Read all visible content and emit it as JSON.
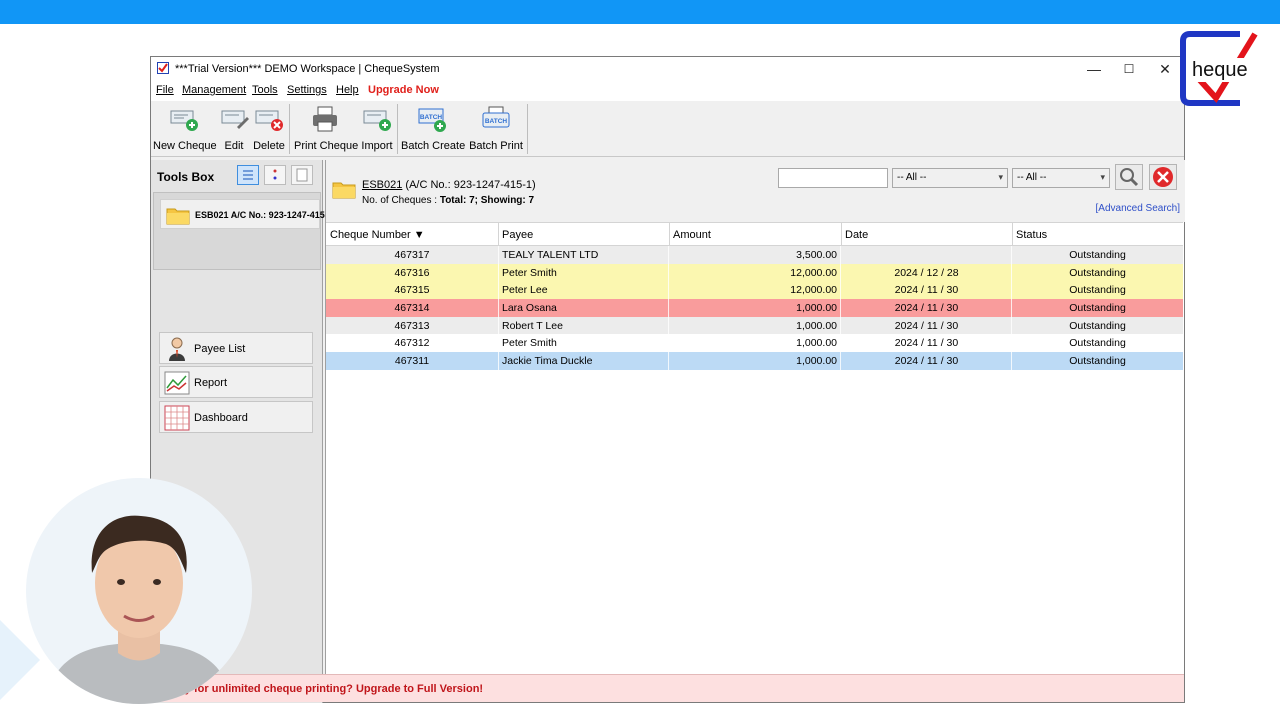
{
  "window": {
    "title": "***Trial Version*** DEMO Workspace | ChequeSystem",
    "controls": {
      "minimize": "—",
      "maximize": "☐",
      "close": "✕"
    }
  },
  "menu": {
    "items": [
      "File",
      "Management",
      "Tools",
      "Settings",
      "Help"
    ],
    "upgrade": "Upgrade Now"
  },
  "toolbar": {
    "buttons": [
      {
        "label": "New Cheque",
        "icon": "new-cheque-icon"
      },
      {
        "label": "Edit",
        "icon": "edit-icon"
      },
      {
        "label": "Delete",
        "icon": "delete-icon"
      },
      {
        "label": "Print Cheque",
        "icon": "printer-icon"
      },
      {
        "label": "Import",
        "icon": "import-icon"
      },
      {
        "label": "Batch Create",
        "icon": "batch-create-icon"
      },
      {
        "label": "Batch Print",
        "icon": "batch-print-icon"
      }
    ],
    "batch_badge": "BATCH"
  },
  "toolsbox": {
    "title": "Tools Box",
    "account_item": "ESB021 A/C No.: 923-1247-415",
    "nav": [
      {
        "label": "Payee List",
        "icon": "person-icon"
      },
      {
        "label": "Report",
        "icon": "chart-icon"
      },
      {
        "label": "Dashboard",
        "icon": "dashboard-icon"
      }
    ]
  },
  "header": {
    "account_code": "ESB021",
    "account_detail": " (A/C No.: 923-1247-415-1)",
    "count_prefix": "No. of Cheques : ",
    "count_value": "Total: 7; Showing: 7",
    "search_placeholder": "",
    "filter1": "-- All --",
    "filter2": "-- All --",
    "advanced_search": "[Advanced Search]"
  },
  "table": {
    "columns": [
      "Cheque Number ▼",
      "Payee",
      "Amount",
      "Date",
      "Status"
    ],
    "rows": [
      {
        "number": "467317",
        "payee": "TEALY TALENT LTD",
        "amount": "3,500.00",
        "date": "",
        "status": "Outstanding",
        "bg": "#ececec"
      },
      {
        "number": "467316",
        "payee": "Peter Smith",
        "amount": "12,000.00",
        "date": "2024 / 12 / 28",
        "status": "Outstanding",
        "bg": "#fbf7b0"
      },
      {
        "number": "467315",
        "payee": "Peter Lee",
        "amount": "12,000.00",
        "date": "2024 / 11 / 30",
        "status": "Outstanding",
        "bg": "#fbf7b0"
      },
      {
        "number": "467314",
        "payee": "Lara Osana",
        "amount": "1,000.00",
        "date": "2024 / 11 / 30",
        "status": "Outstanding",
        "bg": "#f99c9c"
      },
      {
        "number": "467313",
        "payee": "Robert T Lee",
        "amount": "1,000.00",
        "date": "2024 / 11 / 30",
        "status": "Outstanding",
        "bg": "#ececec"
      },
      {
        "number": "467312",
        "payee": "Peter Smith",
        "amount": "1,000.00",
        "date": "2024 / 11 / 30",
        "status": "Outstanding",
        "bg": "#ffffff"
      },
      {
        "number": "467311",
        "payee": "Jackie Tima Duckle",
        "amount": "1,000.00",
        "date": "2024 / 11 / 30",
        "status": "Outstanding",
        "bg": "#bcdaf5"
      }
    ]
  },
  "footer": {
    "message": "ady for unlimited cheque printing? Upgrade to Full Version!"
  },
  "colors": {
    "top_bar": "#1196f6",
    "upgrade_red": "#e0201b",
    "footer_bg": "#fde0e0",
    "footer_text": "#c0151a"
  }
}
